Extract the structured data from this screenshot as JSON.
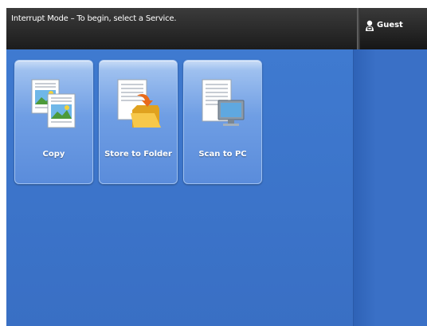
{
  "header": {
    "message": "Interrupt Mode – To begin, select a Service.",
    "user_label": "Guest",
    "user_icon": "guest-user-icon"
  },
  "services": [
    {
      "label": "Copy",
      "icon": "copy-icon"
    },
    {
      "label": "Store to Folder",
      "icon": "store-to-folder-icon"
    },
    {
      "label": "Scan to PC",
      "icon": "scan-to-pc-icon"
    }
  ],
  "colors": {
    "background_blue": "#3a72c6",
    "header_dark": "#2a2a2a",
    "tile_blue": "#6f9ee4"
  }
}
